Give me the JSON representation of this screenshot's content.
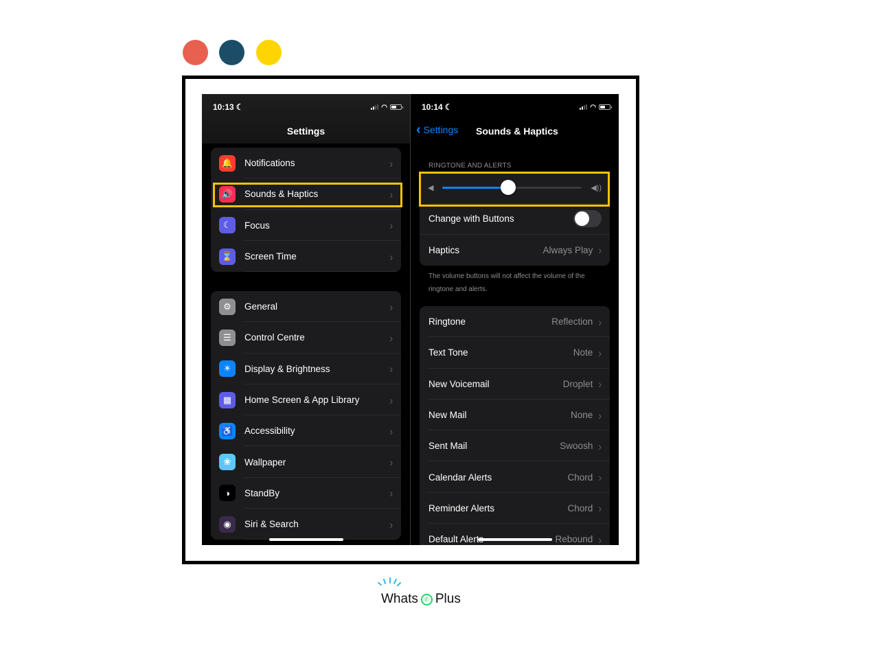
{
  "decor": {
    "dots": [
      {
        "name": "coral",
        "color": "#e8604f"
      },
      {
        "name": "teal",
        "color": "#1b4d68"
      },
      {
        "name": "yellow",
        "color": "#ffd500"
      }
    ],
    "highlight_color": "#f5c400"
  },
  "left_screen": {
    "status": {
      "time": "10:13",
      "moon_icon": "moon-icon",
      "battery_percent": 55
    },
    "title": "Settings",
    "groups": [
      [
        {
          "label": "Notifications",
          "icon": "bell-icon",
          "color": "#ff3b30",
          "glyph": "🔔"
        },
        {
          "label": "Sounds & Haptics",
          "icon": "speaker-icon",
          "color": "#ff2d55",
          "glyph": "🔊",
          "highlighted": true
        },
        {
          "label": "Focus",
          "icon": "moon-icon",
          "color": "#5e5ce6",
          "glyph": "☾"
        },
        {
          "label": "Screen Time",
          "icon": "hourglass-icon",
          "color": "#5e5ce6",
          "glyph": "⌛"
        }
      ],
      [
        {
          "label": "General",
          "icon": "gear-icon",
          "color": "#8e8e93",
          "glyph": "⚙"
        },
        {
          "label": "Control Centre",
          "icon": "toggles-icon",
          "color": "#8e8e93",
          "glyph": "☰"
        },
        {
          "label": "Display & Brightness",
          "icon": "sun-icon",
          "color": "#0a84ff",
          "glyph": "☀"
        },
        {
          "label": "Home Screen & App Library",
          "icon": "app-grid-icon",
          "color": "#5e5ce6",
          "glyph": "▦"
        },
        {
          "label": "Accessibility",
          "icon": "accessibility-icon",
          "color": "#0a84ff",
          "glyph": "♿"
        },
        {
          "label": "Wallpaper",
          "icon": "flower-icon",
          "color": "#5ac8fa",
          "glyph": "❀"
        },
        {
          "label": "StandBy",
          "icon": "standby-icon",
          "color": "#000000",
          "glyph": "◑"
        },
        {
          "label": "Siri & Search",
          "icon": "siri-icon",
          "color": "#3a2a4a",
          "glyph": "◉"
        }
      ]
    ]
  },
  "right_screen": {
    "status": {
      "time": "10:14",
      "battery_percent": 55
    },
    "back_label": "Settings",
    "title": "Sounds & Haptics",
    "section_label": "RINGTONE AND ALERTS",
    "volume": {
      "value_fraction": 0.47
    },
    "change_with_buttons": {
      "label": "Change with Buttons",
      "on": false
    },
    "haptics": {
      "label": "Haptics",
      "value": "Always Play"
    },
    "footnote": "The volume buttons will not affect the volume of the ringtone and alerts.",
    "tones": [
      {
        "label": "Ringtone",
        "value": "Reflection"
      },
      {
        "label": "Text Tone",
        "value": "Note"
      },
      {
        "label": "New Voicemail",
        "value": "Droplet"
      },
      {
        "label": "New Mail",
        "value": "None"
      },
      {
        "label": "Sent Mail",
        "value": "Swoosh"
      },
      {
        "label": "Calendar Alerts",
        "value": "Chord"
      },
      {
        "label": "Reminder Alerts",
        "value": "Chord"
      },
      {
        "label": "Default Alerts",
        "value": "Rebound"
      }
    ]
  },
  "brand": {
    "left": "Whats",
    "right": "Plus",
    "accent": "#25d366",
    "spark_color": "#3ab8e0"
  }
}
